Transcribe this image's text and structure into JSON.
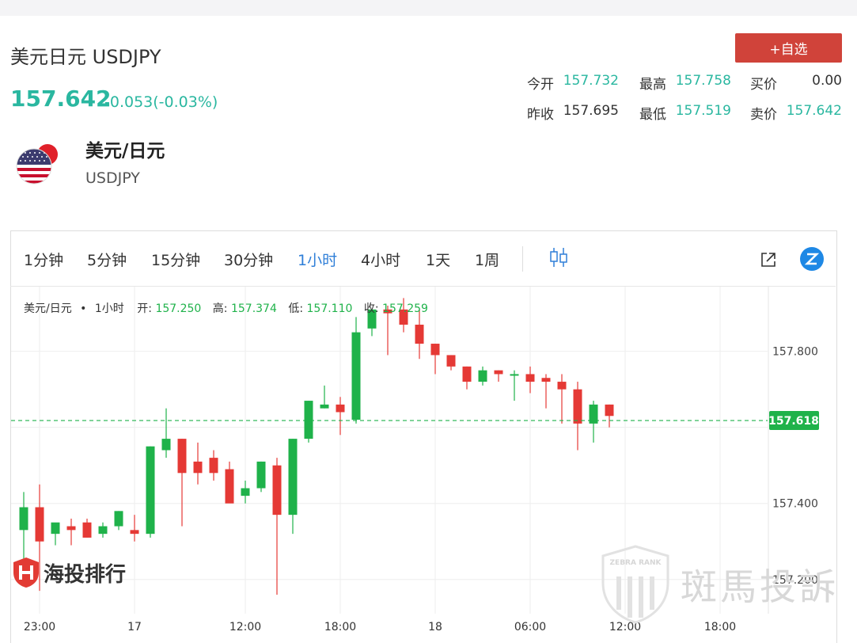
{
  "header": {
    "title": "美元日元 USDJPY",
    "price": "157.642",
    "change": "-0.053(-0.03%)",
    "follow_button": "+自选"
  },
  "stats": [
    {
      "label": "今开",
      "value": "157.732"
    },
    {
      "label": "最高",
      "value": "157.758"
    },
    {
      "label": "买价",
      "value": "0.00"
    },
    {
      "label": "昨收",
      "value": "157.695"
    },
    {
      "label": "最低",
      "value": "157.519"
    },
    {
      "label": "卖价",
      "value": "157.642"
    }
  ],
  "pair": {
    "name": "美元/日元",
    "code": "USDJPY",
    "flag_icon": "us-flag-icon"
  },
  "toolbar": {
    "timeframes": [
      "1分钟",
      "5分钟",
      "15分钟",
      "30分钟",
      "1小时",
      "4小时",
      "1天",
      "1周"
    ],
    "active_timeframe": "1小时",
    "icons": [
      "candlestick-icon",
      "external-link-icon",
      "brand-z-icon"
    ]
  },
  "legend": {
    "pair": "美元/日元",
    "dot": "•",
    "interval": "1小时",
    "open_label": "开:",
    "open": "157.250",
    "high_label": "高:",
    "high": "157.374",
    "low_label": "低:",
    "low": "157.110",
    "close_label": "收:",
    "close": "157.259"
  },
  "watermarks": {
    "left": "海投排行",
    "right": "斑馬投訴",
    "badge": "ZEBRA RANK"
  },
  "colors": {
    "up": "#1fb24a",
    "down": "#e53935",
    "accent": "#2ab7a0",
    "button": "#d0433a",
    "current_price": "#1fb24a"
  },
  "chart_data": {
    "type": "candlestick",
    "y_ticks": [
      "157.200",
      "157.400",
      "157.800"
    ],
    "ylim": [
      157.11,
      157.97
    ],
    "x_ticks": [
      "23:00",
      "17",
      "12:00",
      "18:00",
      "18",
      "06:00",
      "12:00",
      "18:00"
    ],
    "current_price": "157.618",
    "candles": [
      {
        "o": 157.33,
        "h": 157.43,
        "l": 157.21,
        "c": 157.39
      },
      {
        "o": 157.39,
        "h": 157.45,
        "l": 157.17,
        "c": 157.3
      },
      {
        "o": 157.32,
        "h": 157.34,
        "l": 157.29,
        "c": 157.35
      },
      {
        "o": 157.34,
        "h": 157.36,
        "l": 157.29,
        "c": 157.33
      },
      {
        "o": 157.35,
        "h": 157.36,
        "l": 157.31,
        "c": 157.31
      },
      {
        "o": 157.32,
        "h": 157.35,
        "l": 157.31,
        "c": 157.34
      },
      {
        "o": 157.34,
        "h": 157.38,
        "l": 157.33,
        "c": 157.38
      },
      {
        "o": 157.33,
        "h": 157.37,
        "l": 157.3,
        "c": 157.32
      },
      {
        "o": 157.32,
        "h": 157.55,
        "l": 157.31,
        "c": 157.55
      },
      {
        "o": 157.54,
        "h": 157.65,
        "l": 157.52,
        "c": 157.57
      },
      {
        "o": 157.57,
        "h": 157.57,
        "l": 157.34,
        "c": 157.48
      },
      {
        "o": 157.51,
        "h": 157.56,
        "l": 157.45,
        "c": 157.48
      },
      {
        "o": 157.52,
        "h": 157.54,
        "l": 157.46,
        "c": 157.48
      },
      {
        "o": 157.49,
        "h": 157.51,
        "l": 157.42,
        "c": 157.4
      },
      {
        "o": 157.42,
        "h": 157.46,
        "l": 157.4,
        "c": 157.44
      },
      {
        "o": 157.44,
        "h": 157.51,
        "l": 157.43,
        "c": 157.51
      },
      {
        "o": 157.5,
        "h": 157.52,
        "l": 157.16,
        "c": 157.37
      },
      {
        "o": 157.37,
        "h": 157.57,
        "l": 157.32,
        "c": 157.57
      },
      {
        "o": 157.57,
        "h": 157.67,
        "l": 157.56,
        "c": 157.67
      },
      {
        "o": 157.65,
        "h": 157.71,
        "l": 157.65,
        "c": 157.66
      },
      {
        "o": 157.66,
        "h": 157.68,
        "l": 157.58,
        "c": 157.64
      },
      {
        "o": 157.62,
        "h": 157.89,
        "l": 157.61,
        "c": 157.85
      },
      {
        "o": 157.86,
        "h": 157.91,
        "l": 157.84,
        "c": 157.91
      },
      {
        "o": 157.91,
        "h": 157.92,
        "l": 157.79,
        "c": 157.9
      },
      {
        "o": 157.91,
        "h": 157.94,
        "l": 157.85,
        "c": 157.87
      },
      {
        "o": 157.87,
        "h": 157.91,
        "l": 157.78,
        "c": 157.82
      },
      {
        "o": 157.82,
        "h": 157.82,
        "l": 157.74,
        "c": 157.79
      },
      {
        "o": 157.79,
        "h": 157.79,
        "l": 157.75,
        "c": 157.76
      },
      {
        "o": 157.76,
        "h": 157.76,
        "l": 157.7,
        "c": 157.72
      },
      {
        "o": 157.72,
        "h": 157.76,
        "l": 157.71,
        "c": 157.75
      },
      {
        "o": 157.75,
        "h": 157.75,
        "l": 157.72,
        "c": 157.74
      },
      {
        "o": 157.74,
        "h": 157.75,
        "l": 157.67,
        "c": 157.74
      },
      {
        "o": 157.74,
        "h": 157.76,
        "l": 157.69,
        "c": 157.72
      },
      {
        "o": 157.73,
        "h": 157.74,
        "l": 157.65,
        "c": 157.72
      },
      {
        "o": 157.72,
        "h": 157.74,
        "l": 157.61,
        "c": 157.7
      },
      {
        "o": 157.7,
        "h": 157.72,
        "l": 157.54,
        "c": 157.61
      },
      {
        "o": 157.61,
        "h": 157.67,
        "l": 157.56,
        "c": 157.66
      },
      {
        "o": 157.66,
        "h": 157.66,
        "l": 157.6,
        "c": 157.63
      }
    ]
  }
}
